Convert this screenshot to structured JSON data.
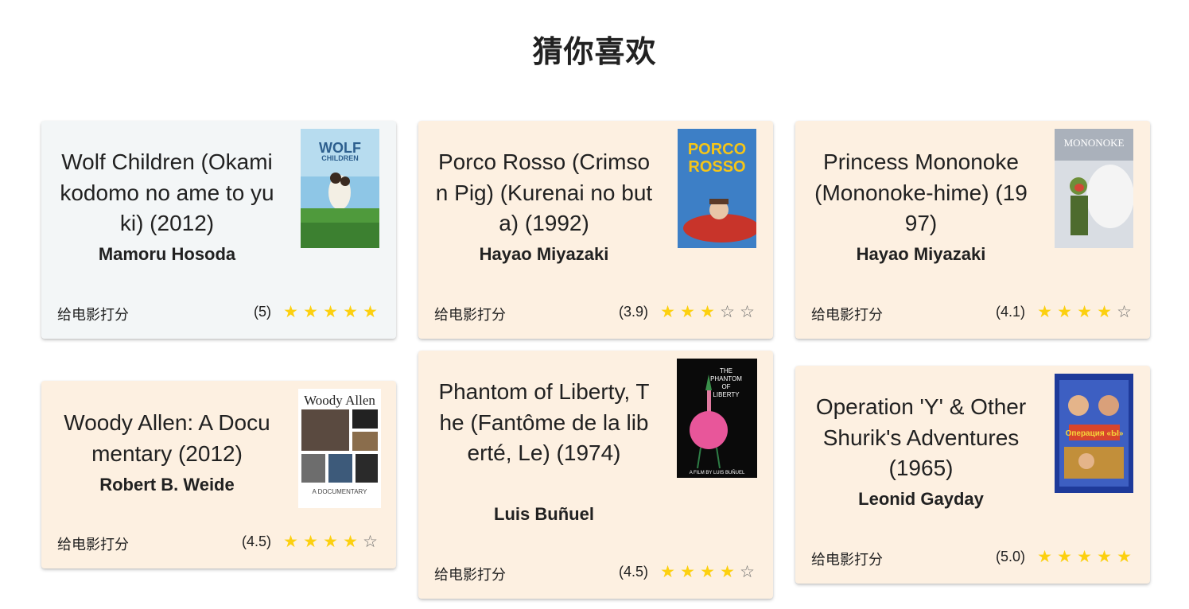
{
  "page": {
    "title": "猜你喜欢"
  },
  "colors": {
    "star_on": "#fcd00f",
    "star_off": "#6e6e6e",
    "card_bg": "#fdf0e1",
    "card_bg_alt": "#f3f6f7"
  },
  "movies": [
    {
      "title": "Wolf Children (Okami kodomo no ame to yuki) (2012)",
      "director": "Mamoru Hosoda",
      "rate_label": "给电影打分",
      "rating_text": "(5)",
      "stars": 5,
      "poster_text": "WOLF CHILDREN"
    },
    {
      "title": "Porco Rosso (Crimson Pig) (Kurenai no buta) (1992)",
      "director": "Hayao Miyazaki",
      "rate_label": "给电影打分",
      "rating_text": "(3.9)",
      "stars": 3,
      "poster_text": "PORCO ROSSO"
    },
    {
      "title": "Princess Mononoke (Mononoke-hime) (1997)",
      "director": "Hayao Miyazaki",
      "rate_label": "给电影打分",
      "rating_text": "(4.1)",
      "stars": 4,
      "poster_text": "MONONOKE"
    },
    {
      "title": "Woody Allen: A Documentary (2012)",
      "director": "Robert B. Weide",
      "rate_label": "给电影打分",
      "rating_text": "(4.5)",
      "stars": 4,
      "poster_text": "Woody Allen",
      "poster_subtext": "A DOCUMENTARY"
    },
    {
      "title": "Phantom of Liberty, The (Fantôme de la liberté, Le) (1974)",
      "director": "Luis Buñuel",
      "rate_label": "给电影打分",
      "rating_text": "(4.5)",
      "stars": 4,
      "poster_text": "THE PHANTOM OF LIBERTY",
      "poster_subtext": "A FILM BY LUIS BUÑUEL"
    },
    {
      "title": "Operation 'Y' & Other Shurik's Adventures (1965)",
      "director": "Leonid Gayday",
      "rate_label": "给电影打分",
      "rating_text": "(5.0)",
      "stars": 5,
      "poster_text": "Операция «Ы»"
    }
  ]
}
